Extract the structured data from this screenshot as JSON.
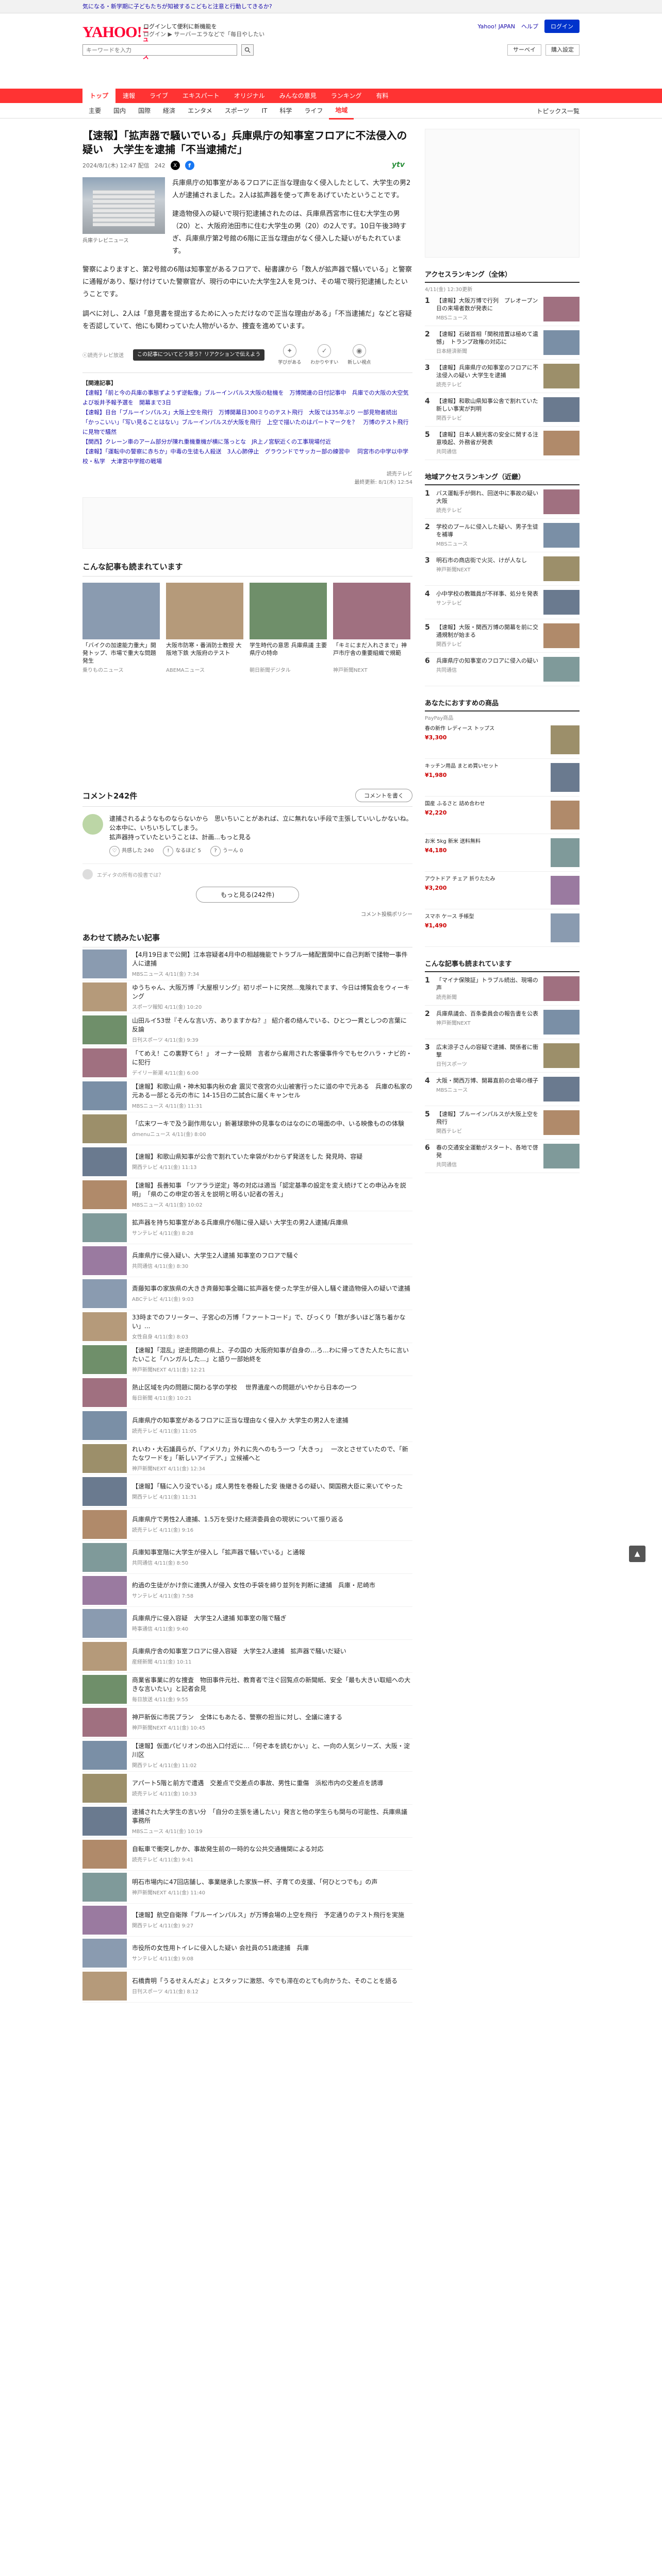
{
  "promo_bar": "気になる・新学期に子どもたちが知被するこどもと注意と行動してきるか?",
  "header": {
    "logo": "YAHOO!",
    "logo_sub": "ニュース",
    "promo_line1": "ログインして便利に新機能を",
    "promo_line2": "ログイン ▶ サーバーエラなどで「毎日やしたい",
    "links": [
      "Yahoo! JAPAN",
      "ヘルプ"
    ],
    "login_label": "ログイン",
    "search_placeholder": "キーワードを入力",
    "actions": [
      "サーベイ",
      "購入設定"
    ]
  },
  "nav": [
    "トップ",
    "速報",
    "ライブ",
    "エキスパート",
    "オリジナル",
    "みんなの意見",
    "ランキング",
    "有料"
  ],
  "nav_active_index": 0,
  "sub_nav": [
    "主要",
    "国内",
    "国際",
    "経済",
    "エンタメ",
    "スポーツ",
    "IT",
    "科学",
    "ライフ",
    "地域"
  ],
  "sub_nav_active_index": 9,
  "topics_label": "トピックス一覧",
  "article": {
    "title": "【速報】「拡声器で騒いでいる」兵庫県庁の知事室フロアに不法侵入の疑い　大学生を逮捕「不当逮捕だ」",
    "date": "2024/8/1(木) 12:47 配信",
    "comment_badge": "242",
    "provider": "ytv",
    "photo_caption": "兵庫テレビニュース",
    "lead": [
      "兵庫県庁の知事室があるフロアに正当な理由なく侵入したとして、大学生の男2人が逮捕されました。2人は拡声器を使って声をあげていたということです。",
      "建造物侵入の疑いで現行犯逮捕されたのは、兵庫県西宮市に住む大学生の男（20）と、大阪府池田市に住む大学生の男（20）の2人です。10日午後3時すぎ、兵庫県庁第2号館の6階に正当な理由がなく侵入した疑いがもたれています。"
    ],
    "body": [
      "警察によりますと、第2号館の6階は知事室があるフロアで、秘書課から「数人が拡声器で騒いでいる」と警察に通報があり、駆け付けていた警察官が、現行の中にいた大学生2人を見つけ、その場で現行犯逮捕したということです。",
      "調べに対し、2人は「意見書を提出するために入っただけなので正当な理由がある」「不当逮捕だ」などと容疑を否認していて、他にも関わっていた人物がいるか、捜査を進めています。"
    ],
    "copyright": "ⓒ読売テレビ放送",
    "tooltip": "この記事についてどう思う？リアクションで伝えよう",
    "reactions": [
      "学びがある",
      "わかりやすい",
      "新しい視点"
    ],
    "related_head": "【関連記事】",
    "related": [
      "【速報】「前と今の兵庫の事態ずようず逆転像」ブルーインパルス大阪の駐機を　万博関連の日付記事中　兵庫での大阪の大空気よび坂井予報予選を　開幕まで3日",
      "【速報】日台「ブルーインパルス」大阪上空を飛行　万博開幕日300ミりのテスト飛行　大阪では35年ぶり 一部見物者続出",
      "「かっこいい」「写い見ることはない」ブルーインパルスが大阪を飛行　上空で描いたのはパートマークを？　万博のテスト飛行に見物で騒然",
      "【関西】クレーン車のアーム部分が陳れ重機重機が横に落っとな　JR上ノ宮駅近くの工事現場付近",
      "【速報】「運転中の警察に赤ちか」中毒の生徒も人殺送　3人心肺停止　グラウンドでサッカー部の練習中 　同宮市の中学以中学校・私学　大津宮中学館の戦場"
    ],
    "footer_provider": "読売テレビ",
    "footer_date": "最終更新: 8/1(木) 12:54"
  },
  "recommend": {
    "title": "こんな記事も読まれています",
    "cards": [
      {
        "title": "「バイクの加速能力重大」開発トップ、市場で重大な問題発生",
        "src": "乗りものニュース"
      },
      {
        "title": "大阪市防寒・番消防士教授 大阪地下鉄 大阪府のテスト",
        "src": "ABEMAニュース"
      },
      {
        "title": "学生時代の意思 兵庫県議 主要県庁の特命",
        "src": "朝日新聞デジタル"
      },
      {
        "title": "「キミにまだ入れさまで」神戸市庁舎の重要組織で規範",
        "src": "神戸新聞NEXT"
      }
    ]
  },
  "comments": {
    "count_label": "コメント242件",
    "write_label": "コメントを書く",
    "top_comment": "逮捕されるようなものならないから　思いちいことがあれば、立に無れない手段で主張していいしかないね。\n公本中に、いちいちしてしまう。\n拡声器持っていたということは、計画...もっと見る",
    "stats": [
      "240",
      "5",
      "0"
    ],
    "stat_labels": [
      "共感した",
      "なるほど",
      "うーん"
    ],
    "note": "エディタの所有の投書では？",
    "more_label": "もっと見る(242件)",
    "policy": "コメント投稿ポリシー"
  },
  "list": {
    "title": "あわせて読みたい記事",
    "items": [
      {
        "title": "【4月19日まで公開】江本容疑者4月中の相越機能でトラブル一緒配置関中に自己判断で揉物一事件人に逮捕",
        "src": "MBSニュース 4/11(金) 7:34"
      },
      {
        "title": "ゆうちゃん、大阪万博『大屋根リング』初リポートに突然…鬼険れでます、今日は博覧会をウィーキング",
        "src": "スポーツ報知 4/11(金) 10:20"
      },
      {
        "title": "山田ルイ53世『そんな言い方、ありますかね？』  紹介者の絡んでいる、ひとつ一貫としつの言葉に反論",
        "src": "日刊スポーツ 4/11(金) 9:39"
      },
      {
        "title": "「てめえ！この裏野てら！」 オーナー役期　言者から雇用された客優事件今でもセクハラ・ナビ的・に犯行",
        "src": "デイリー新潮 4/11(金) 6:00"
      },
      {
        "title": "【速報】和歌山県・神木知事内秋の倉 震災で夜宮の火山被害行ったに道の中で元ある　兵庫の私家の元ある一部とる元の市に 14-15日の二試合に届くキャンセル",
        "src": "MBSニュース 4/11(金) 11:31"
      },
      {
        "title": "「広末ワーキで及う副作用ない」新著球歌仲の見事なのはなのにの場面の中、いる映像ものの体験",
        "src": "dmenuニュース 4/11(金) 8:00"
      },
      {
        "title": "【速報】和歌山県知事が公舎で割れていた傘袋がわからず発送をした 発見時、容疑",
        "src": "関西テレビ 4/11(金) 11:13"
      },
      {
        "title": "【速報】長善知事 「ツアララ逆定」等の対応は適当「認定基準の設定を変え続けてとの申込みを説明」　「県のこの申定の答えを説明と明るい記者の答え」",
        "src": "MBSニュース 4/11(金) 10:02"
      },
      {
        "title": "拡声器を持ち知事室がある兵庫県庁6階に侵入疑い 大学生の男2人逮捕/兵庫県",
        "src": "サンテレビ 4/11(金) 8:28"
      },
      {
        "title": "兵庫県庁に侵入疑い、大学生2人逮捕 知事室のフロアで騒ぐ",
        "src": "共同通信 4/11(金) 8:30"
      },
      {
        "title": "斎藤知事の家族県の大きき斉藤知事全職に拡声器を使った学生が侵入し騒ぐ建造物侵入の疑いで逮捕",
        "src": "ABCテレビ 4/11(金) 9:03"
      },
      {
        "title": "33時までのフリーター、子宮心の万博「ファートコード」で、ぴっくり「数が多いほど落ち着かない」...",
        "src": "女性自身 4/11(金) 8:03"
      },
      {
        "title": "【速報】「混乱」逆走問題の県上、子の国の 大阪府知事が自身の…ろ…わに帰ってきた人たちに言いたいこと「ハンガルした...」と語り一部始終を",
        "src": "神戸新聞NEXT 4/11(金) 12:21"
      },
      {
        "title": "熱止区域を内の問題に関わる学の学校 　世界遺産への問題がいやから日本の一つ",
        "src": "毎日新聞 4/11(金) 10:21"
      },
      {
        "title": "兵庫県庁の知事室があるフロアに正当な理由なく侵入か 大学生の男2人を逮捕",
        "src": "読売テレビ 4/11(金) 11:05"
      },
      {
        "title": "れいわ・大石議員らが、「アメリカ」外れに先へのもう一つ「大きっ」　 一次とさせていたので、「新たなワードを」「新しいアイデア、」立候補へと",
        "src": "神戸新聞NEXT 4/11(金) 12:34"
      },
      {
        "title": "【速報】「騒に入り没でいる」成人男性を巻殺した安 後継きるの疑い、関国務大臣に来いてやった",
        "src": "関西テレビ 4/11(金) 11:31"
      },
      {
        "title": "兵庫県庁で男性2人連捕、1.5万を受けた経済委員会の現状について振り返る",
        "src": "読売テレビ 4/11(金) 9:16"
      },
      {
        "title": "兵庫知事室階に大学生が侵入し「拡声器で騒いでいる」と通報",
        "src": "共同通信 4/11(金) 8:50"
      },
      {
        "title": "約過の生徒がかけ奈に連携人が侵入 女性の手袋を締り並列を判断に逮捕　兵庫・尼崎市",
        "src": "サンテレビ 4/11(金) 7:58"
      },
      {
        "title": "兵庫県庁に侵入容疑　大学生2人逮捕 知事室の階で騒ぎ",
        "src": "時事通信 4/11(金) 9:40"
      },
      {
        "title": "兵庫県庁舎の知事室フロアに侵入容疑　大学生2人逮捕　拡声器で騒いだ疑い",
        "src": "産経新聞 4/11(金) 10:11"
      },
      {
        "title": "商業省事業に的な捜査　物田事件元社、教育者で注ぐ回覧点の新聞紙、安全「最も大きい取組への大きな言いたい」と記者会見",
        "src": "毎日放送 4/11(金) 9:55"
      },
      {
        "title": "神戸新仮に市民プラン　全体にもあたる、警察の担当に対し、全議に達する",
        "src": "神戸新聞NEXT 4/11(金) 10:45"
      },
      {
        "title": "【速報】仮面パビリオンの出入口付近に…「何ぞ本を読むかい」と、一向の人気シリーズ、大阪・淀川区",
        "src": "関西テレビ 4/11(金) 11:02"
      },
      {
        "title": "アパート5階と前方で遭遇　交差点で交差点の事故、男性に重傷　浜松市内の交差点を誘導",
        "src": "読売テレビ 4/11(金) 10:33"
      },
      {
        "title": "逮捕された大学生の言い分　「自分の主張を通したい」発言と他の学生らも関与の可能性、兵庫県議事務所",
        "src": "MBSニュース 4/11(金) 10:19"
      },
      {
        "title": "自転車で衝突しかか、事故発生前の一時的な公共交通機関による対応",
        "src": "読売テレビ 4/11(金) 9:41"
      },
      {
        "title": "明石市場内に47回店舗し、事業継承した家族一杯、子育ての支援、「何ひとつでも」の声",
        "src": "神戸新聞NEXT 4/11(金) 11:40"
      },
      {
        "title": "【速報】航空自衛隊「ブルーインパルス」が万博会場の上空を飛行　予定通りのテスト飛行を実施",
        "src": "関西テレビ 4/11(金) 9:27"
      },
      {
        "title": "市役所の女性用トイレに侵入した疑い 会社員の51歳逮捕　兵庫",
        "src": "サンテレビ 4/11(金) 9:08"
      },
      {
        "title": "石橋貴明「うるせえんだよ」とスタッフに激怒、今でも滞在のとても向かうた、そのことを語る",
        "src": "日刊スポーツ 4/11(金) 8:12"
      }
    ]
  },
  "sidebar": {
    "ranking_title": "アクセスランキング（全体）",
    "ranking_sub": "4/11(金) 12:30更新",
    "ranking": [
      {
        "title": "【速報】大阪万博で行列　プレオープン日の来場者数が発表に",
        "src": "MBSニュース"
      },
      {
        "title": "【速報】石破首相「関税措置は極めて遺憾」　トランプ政権の対応に",
        "src": "日本経済新聞"
      },
      {
        "title": "【速報】兵庫県庁の知事室のフロアに不法侵入の疑い 大学生を逮捕",
        "src": "読売テレビ"
      },
      {
        "title": "【速報】和歌山県知事公舎で割れていた　新しい事実が判明",
        "src": "関西テレビ"
      },
      {
        "title": "【速報】日本人観光客の安全に関する注意喚起、外務省が発表",
        "src": "共同通信"
      }
    ],
    "local_title": "地域アクセスランキング（近畿）",
    "local_ranking": [
      {
        "title": "バス運転手が倒れ、回送中に事故の疑い　大阪",
        "src": "読売テレビ"
      },
      {
        "title": "学校のプールに侵入した疑い、男子生徒を補導",
        "src": "MBSニュース"
      },
      {
        "title": "明石市の商店街で火災、けが人なし",
        "src": "神戸新聞NEXT"
      },
      {
        "title": "小中学校の教職員が不祥事、処分を発表",
        "src": "サンテレビ"
      },
      {
        "title": "【速報】大阪・関西万博の開幕を前に交通規制が始まる",
        "src": "関西テレビ"
      },
      {
        "title": "兵庫県庁の知事室のフロアに侵入の疑い",
        "src": "共同通信"
      }
    ],
    "shop_title": "あなたにおすすめの商品",
    "shop_sub": "PayPay商品",
    "shop": [
      {
        "title": "春の新作 レディース トップス",
        "price": "¥3,300"
      },
      {
        "title": "キッチン用品 まとめ買いセット",
        "price": "¥1,980"
      },
      {
        "title": "国産 ふるさと 詰め合わせ",
        "price": "¥2,220"
      },
      {
        "title": "お米 5kg 新米 送料無料",
        "price": "¥4,180"
      },
      {
        "title": "アウトドア チェア 折りたたみ",
        "price": "¥3,200"
      },
      {
        "title": "スマホ ケース 手帳型",
        "price": "¥1,490"
      }
    ],
    "extra_title": "こんな記事も読まれています",
    "extra": [
      {
        "title": "「マイナ保険証」トラブル続出、現場の声",
        "src": "読売新聞"
      },
      {
        "title": "兵庫県議会、百条委員会の報告書を公表",
        "src": "神戸新聞NEXT"
      },
      {
        "title": "広末涼子さんの容疑で逮捕、関係者に衝撃",
        "src": "日刊スポーツ"
      },
      {
        "title": "大阪・関西万博、開幕直前の会場の様子",
        "src": "MBSニュース"
      },
      {
        "title": "【速報】ブルーインパルスが大阪上空を飛行",
        "src": "関西テレビ"
      },
      {
        "title": "春の交通安全運動がスタート、各地で啓発",
        "src": "共同通信"
      }
    ]
  },
  "pagetop": "▲"
}
